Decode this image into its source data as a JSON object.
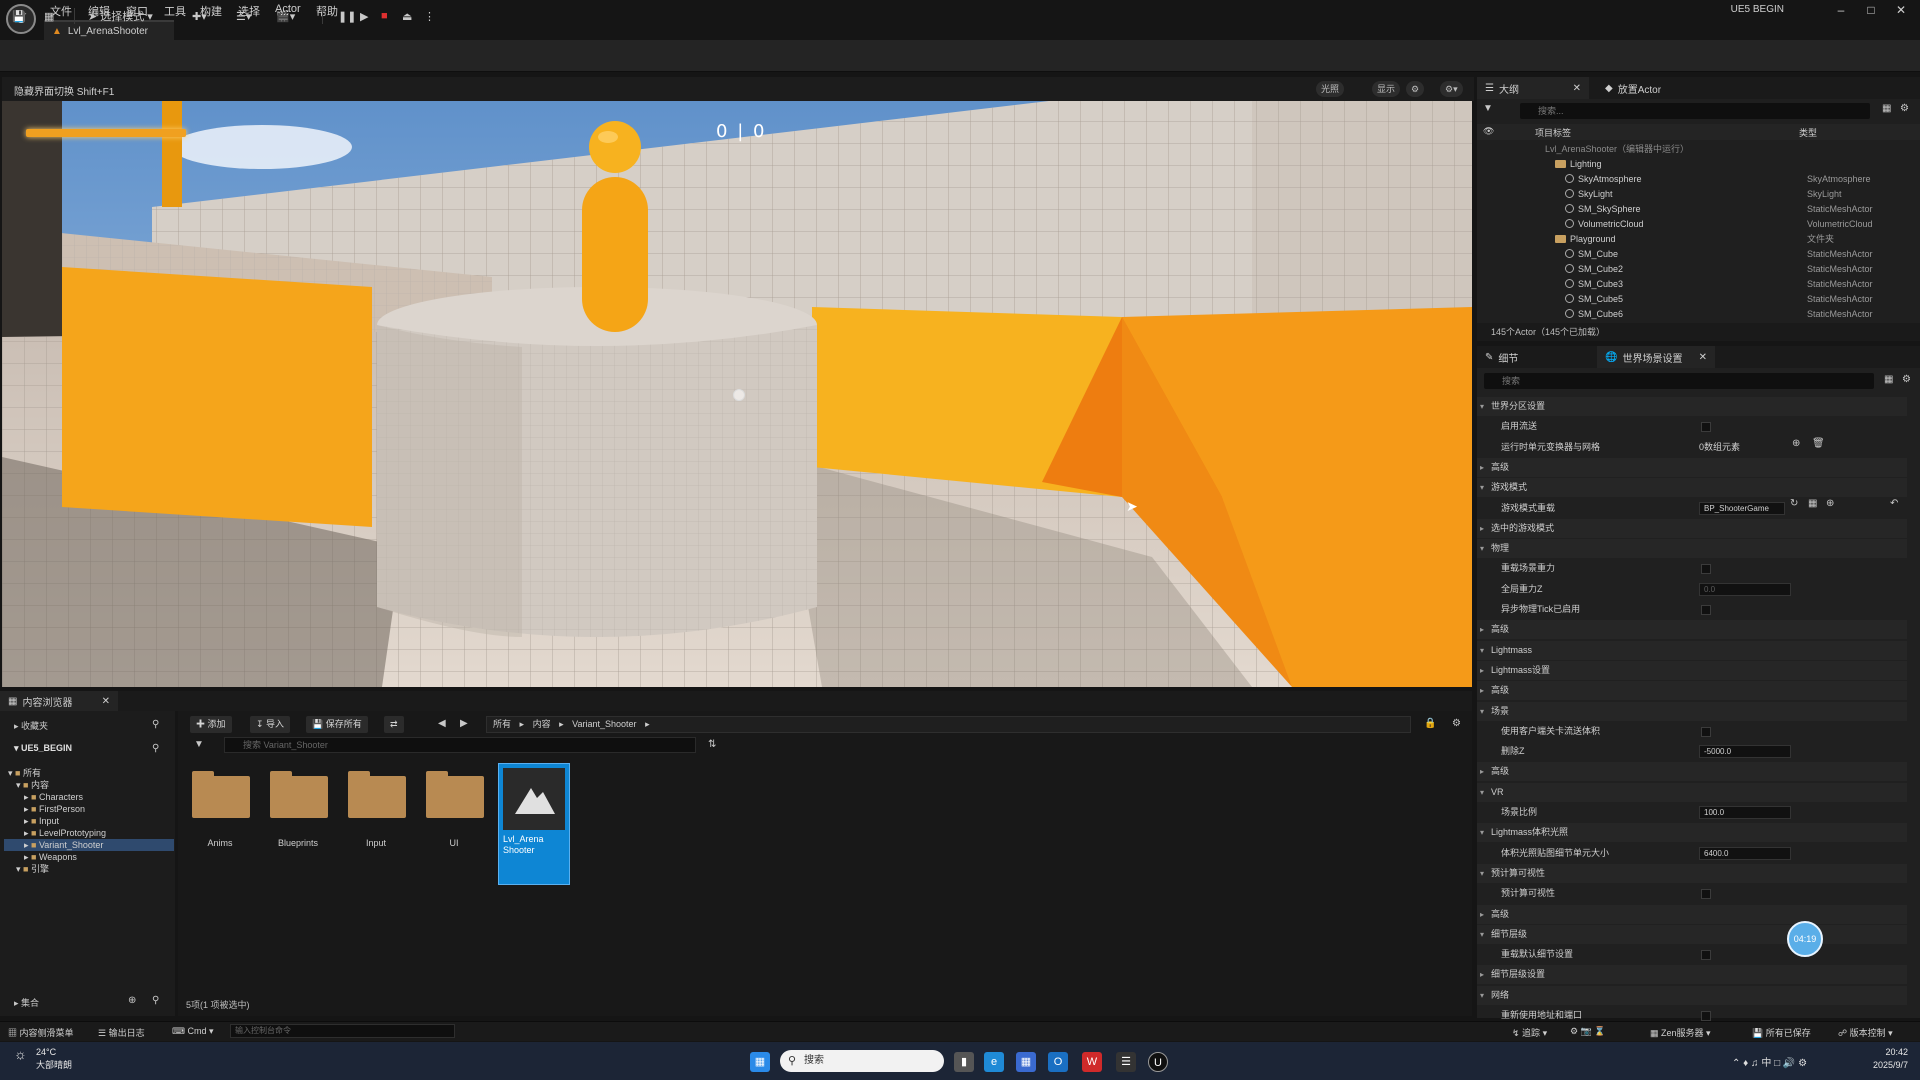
{
  "menubar": {
    "items": [
      "文件",
      "编辑",
      "窗口",
      "工具",
      "构建",
      "选择",
      "Actor",
      "帮助"
    ],
    "project": "UE5 BEGIN"
  },
  "level_tab": {
    "label": "Lvl_ArenaShooter"
  },
  "toolbar": {
    "select_mode": "选择模式"
  },
  "viewport": {
    "hint": "隐藏界面切换 Shift+F1",
    "options": [
      "光照",
      "显示"
    ],
    "score_left": "0",
    "score_right": "0"
  },
  "outliner": {
    "tab_label": "大纲",
    "tab2_label": "放置Actor",
    "search_placeholder": "搜索...",
    "col_label": "项目标签",
    "col_type": "类型",
    "rows": [
      {
        "name": "Lvl_ArenaShooter（编辑器中运行）",
        "type": ""
      },
      {
        "name": "Lighting",
        "type": ""
      },
      {
        "name": "SkyAtmosphere",
        "type": "SkyAtmosphere"
      },
      {
        "name": "SkyLight",
        "type": "SkyLight"
      },
      {
        "name": "SM_SkySphere",
        "type": "StaticMeshActor"
      },
      {
        "name": "VolumetricCloud",
        "type": "VolumetricCloud"
      },
      {
        "name": "Playground",
        "type": "文件夹"
      },
      {
        "name": "SM_Cube",
        "type": "StaticMeshActor"
      },
      {
        "name": "SM_Cube2",
        "type": "StaticMeshActor"
      },
      {
        "name": "SM_Cube3",
        "type": "StaticMeshActor"
      },
      {
        "name": "SM_Cube5",
        "type": "StaticMeshActor"
      },
      {
        "name": "SM_Cube6",
        "type": "StaticMeshActor"
      }
    ],
    "count": "145个Actor（145个已加载）"
  },
  "details": {
    "tab_label": "细节",
    "tab2_label": "世界场景设置",
    "search_placeholder": "搜索",
    "rows": [
      {
        "kind": "cat",
        "label": "世界分区设置",
        "open": true
      },
      {
        "kind": "check",
        "label": "启用流送"
      },
      {
        "kind": "value",
        "label": "运行时单元变换器与网格",
        "value": "0数组元素"
      },
      {
        "kind": "cat",
        "label": "高级",
        "open": false
      },
      {
        "kind": "cat",
        "label": "游戏模式",
        "open": true
      },
      {
        "kind": "combo",
        "label": "游戏模式重载",
        "value": "BP_ShooterGame"
      },
      {
        "kind": "cat",
        "label": "选中的游戏模式",
        "open": false
      },
      {
        "kind": "cat",
        "label": "物理",
        "open": true
      },
      {
        "kind": "check",
        "label": "重载场景重力"
      },
      {
        "kind": "dim",
        "label": "全局重力Z",
        "value": "0.0"
      },
      {
        "kind": "check",
        "label": "异步物理Tick已启用"
      },
      {
        "kind": "cat",
        "label": "高级",
        "open": false
      },
      {
        "kind": "cat",
        "label": "Lightmass",
        "open": true
      },
      {
        "kind": "cat",
        "label": "Lightmass设置",
        "open": false
      },
      {
        "kind": "cat",
        "label": "高级",
        "open": false
      },
      {
        "kind": "cat",
        "label": "场景",
        "open": true
      },
      {
        "kind": "check",
        "label": "使用客户端关卡流送体积"
      },
      {
        "kind": "field",
        "label": "删除Z",
        "value": "-5000.0"
      },
      {
        "kind": "cat",
        "label": "高级",
        "open": false
      },
      {
        "kind": "cat",
        "label": "VR",
        "open": true
      },
      {
        "kind": "field",
        "label": "场景比例",
        "value": "100.0"
      },
      {
        "kind": "cat",
        "label": "Lightmass体积光照",
        "open": true
      },
      {
        "kind": "field",
        "label": "体积光照贴图细节单元大小",
        "value": "6400.0"
      },
      {
        "kind": "cat",
        "label": "预计算可视性",
        "open": true
      },
      {
        "kind": "check",
        "label": "预计算可视性"
      },
      {
        "kind": "cat",
        "label": "高级",
        "open": false
      },
      {
        "kind": "cat",
        "label": "细节层级",
        "open": true
      },
      {
        "kind": "check",
        "label": "重载默认细节设置"
      },
      {
        "kind": "cat",
        "label": "细节层级设置",
        "open": false
      },
      {
        "kind": "cat",
        "label": "网络",
        "open": true
      },
      {
        "kind": "check",
        "label": "重新使用地址和端口"
      }
    ],
    "timer_bubble": "04:19"
  },
  "content_browser": {
    "tab_label": "内容浏览器",
    "favorites": "收藏夹",
    "project_root": "UE5_BEGIN",
    "add_btn": "添加",
    "import_btn": "导入",
    "save_all_btn": "保存所有",
    "path": [
      "所有",
      "内容",
      "Variant_Shooter"
    ],
    "search_placeholder": "搜索 Variant_Shooter",
    "tree": [
      {
        "label": "所有",
        "indent": 0,
        "selected": false
      },
      {
        "label": "内容",
        "indent": 1,
        "selected": false
      },
      {
        "label": "Characters",
        "indent": 2,
        "selected": false
      },
      {
        "label": "FirstPerson",
        "indent": 2,
        "selected": false
      },
      {
        "label": "Input",
        "indent": 2,
        "selected": false
      },
      {
        "label": "LevelPrototyping",
        "indent": 2,
        "selected": false
      },
      {
        "label": "Variant_Shooter",
        "indent": 2,
        "selected": true
      },
      {
        "label": "Weapons",
        "indent": 2,
        "selected": false
      },
      {
        "label": "引擎",
        "indent": 1,
        "selected": false
      }
    ],
    "assets": [
      {
        "label": "Anims",
        "kind": "folder"
      },
      {
        "label": "Blueprints",
        "kind": "folder"
      },
      {
        "label": "Input",
        "kind": "folder"
      },
      {
        "label": "UI",
        "kind": "folder"
      },
      {
        "label": "Lvl_Arena Shooter",
        "kind": "level"
      }
    ],
    "collections": "集合",
    "status": "5项(1 项被选中)"
  },
  "statusbar": {
    "cb_drawer": "内容侧滑菜单",
    "output_log": "输出日志",
    "cmd": "Cmd",
    "cmd_placeholder": "输入控制台命令",
    "trace": "追踪",
    "derived_data": "Zen服务器",
    "saved": "所有已保存",
    "source_control": "版本控制"
  },
  "taskbar": {
    "weather_temp": "24°C",
    "weather_desc": "大部晴朗",
    "search": "搜索",
    "time": "20:42",
    "date": "2025/9/7"
  },
  "colors": {
    "accent": "#0e86d4",
    "orange": "#f0a020"
  }
}
